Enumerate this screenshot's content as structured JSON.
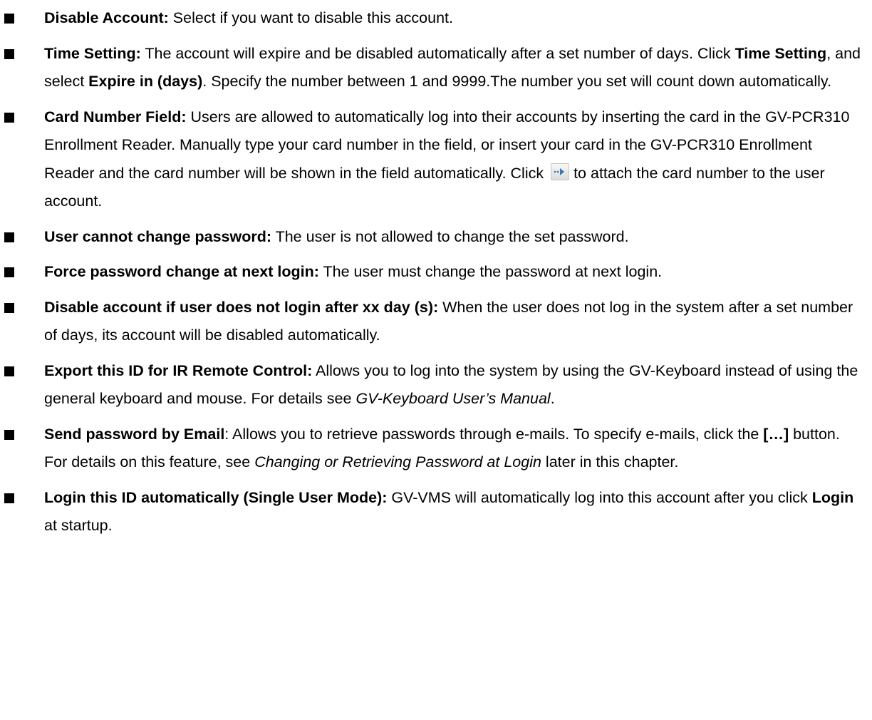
{
  "items": [
    {
      "label": "Disable Account:",
      "text": " Select if you want to disable this account."
    },
    {
      "label": "Time Setting:",
      "text_a": " The account will expire and be disabled automatically after a set number of days. Click ",
      "bold_a": "Time Setting",
      "text_b": ", and select ",
      "bold_b": "Expire in (days)",
      "text_c": ". Specify the number between 1 and 9999.The number you set will count down automatically."
    },
    {
      "label": "Card Number Field:",
      "text_a": " Users are allowed to automatically log into their accounts by inserting the card in the GV-PCR310 Enrollment Reader. Manually type your card number in the field, or insert your card in the GV-PCR310 Enrollment Reader and the card number will be shown in the field automatically. Click ",
      "icon": "attach-arrow-icon",
      "text_b": "to attach the card number to the user account."
    },
    {
      "label": "User cannot change password:",
      "text": " The user is not allowed to change the set password."
    },
    {
      "label": "Force password change at next login:",
      "text": " The user must change the password at next login."
    },
    {
      "label": "Disable account if user does not login after xx day (s):",
      "text": " When the user does not log in the system after a set number of days, its account will be disabled automatically."
    },
    {
      "label": "Export this ID for IR Remote Control:",
      "text_a": " Allows you to log into the system by using the GV-Keyboard instead of using the general keyboard and mouse. For details see ",
      "italic_a": "GV-Keyboard User’s Manual",
      "text_b": "."
    },
    {
      "label": "Send password by Email",
      "text_a": ": Allows you to retrieve passwords through e-mails. To specify e-mails, click the ",
      "bold_a": "[…]",
      "text_b": " button. For details on this feature, see ",
      "italic_a": "Changing or Retrieving Password at Login",
      "text_c": " later in this chapter."
    },
    {
      "label": "Login this ID automatically (Single User Mode):",
      "text_a": " GV-VMS will automatically log into this account after you click ",
      "bold_a": "Login",
      "text_b": " at startup."
    }
  ]
}
